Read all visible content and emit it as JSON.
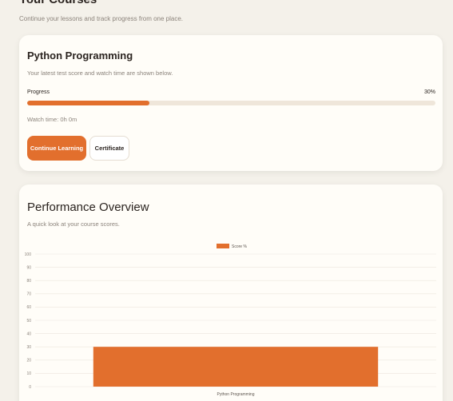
{
  "page": {
    "title": "Your Courses",
    "subtitle": "Continue your lessons and track progress from one place."
  },
  "course": {
    "title": "Python Programming",
    "description": "Your latest test score and watch time are shown below.",
    "progress_label": "Progress",
    "progress_percent_text": "30%",
    "progress_value": 30,
    "watch_time": "Watch time: 0h 0m",
    "continue_label": "Continue Learning",
    "certificate_label": "Certificate"
  },
  "performance": {
    "title": "Performance Overview",
    "description": "A quick look at your course scores."
  },
  "colors": {
    "accent": "#e26f2d",
    "track": "#efe6da",
    "background": "#f4f1ea"
  },
  "chart_data": {
    "type": "bar",
    "categories": [
      "Python Programming"
    ],
    "series": [
      {
        "name": "Score %",
        "values": [
          30
        ]
      }
    ],
    "ylim": [
      0,
      100
    ],
    "yticks": [
      0,
      10,
      20,
      30,
      40,
      50,
      60,
      70,
      80,
      90,
      100
    ],
    "grid": true,
    "legend": "top-center",
    "xlabel": "",
    "ylabel": ""
  }
}
